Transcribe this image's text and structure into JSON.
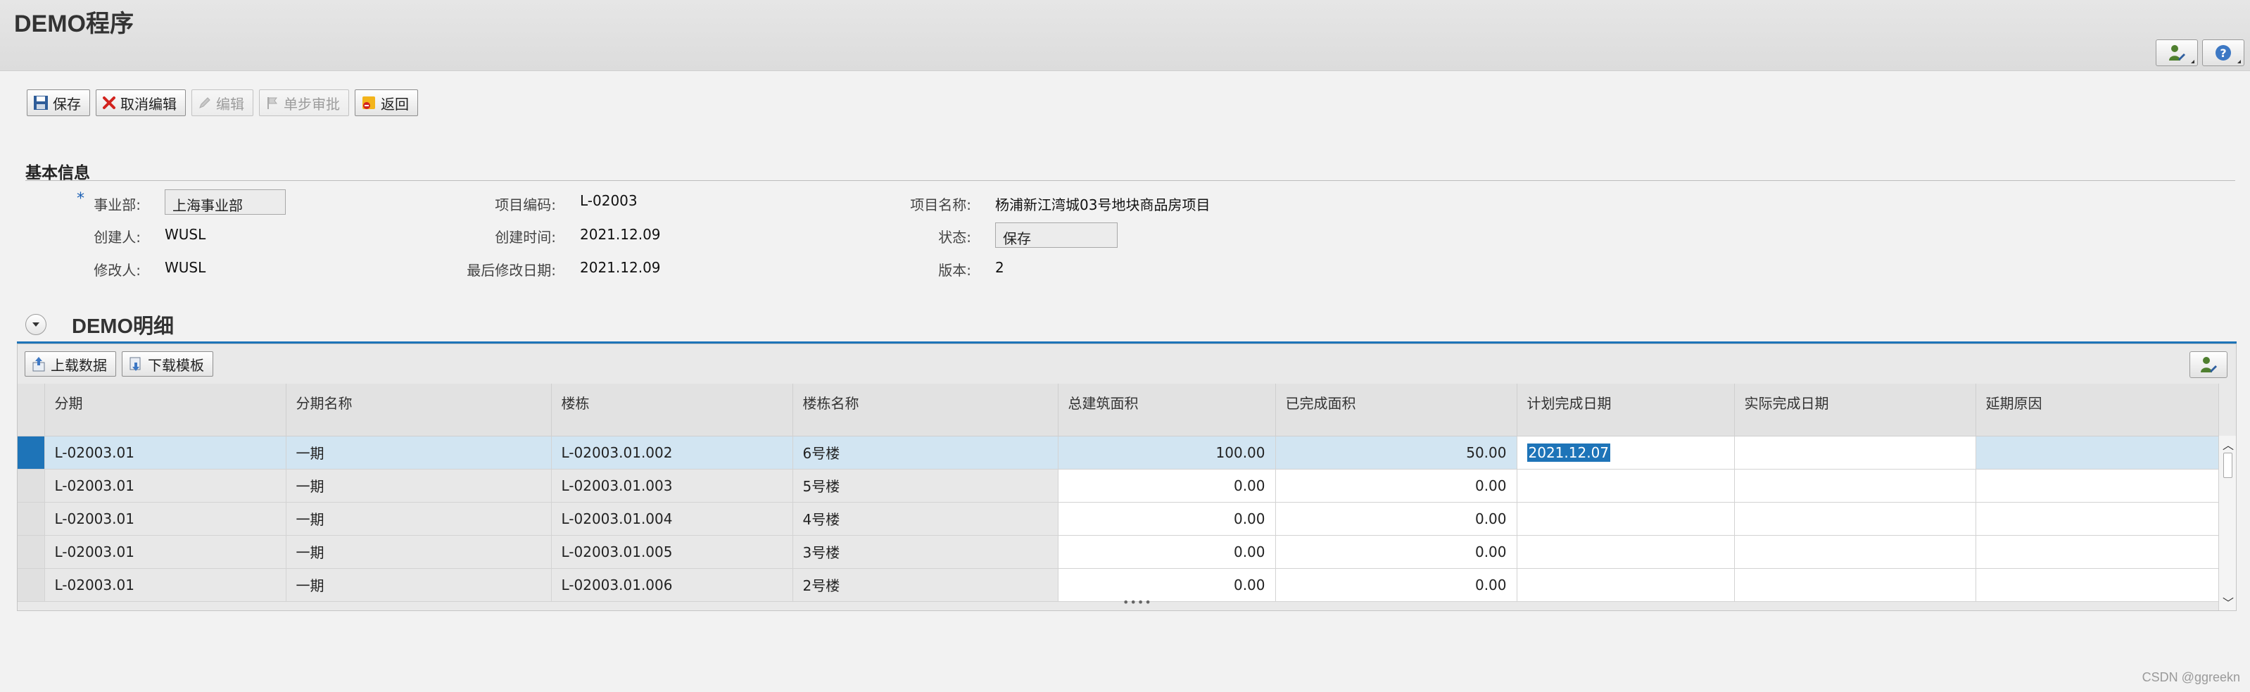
{
  "app": {
    "title": "DEMO程序"
  },
  "toolbar": {
    "buttons": [
      {
        "label": "保存",
        "icon": "save-icon",
        "enabled": true
      },
      {
        "label": "取消编辑",
        "icon": "cancel-icon",
        "enabled": true
      },
      {
        "label": "编辑",
        "icon": "pencil-icon",
        "enabled": false
      },
      {
        "label": "单步审批",
        "icon": "flag-icon",
        "enabled": false
      },
      {
        "label": "返回",
        "icon": "back-icon",
        "enabled": true
      }
    ]
  },
  "basic_info": {
    "section_title": "基本信息",
    "fields": {
      "division_label": "事业部:",
      "division_value": "上海事业部",
      "creator_label": "创建人:",
      "creator_value": "WUSL",
      "modifier_label": "修改人:",
      "modifier_value": "WUSL",
      "project_code_label": "项目编码:",
      "project_code_value": "L-02003",
      "created_time_label": "创建时间:",
      "created_time_value": "2021.12.09",
      "modified_date_label": "最后修改日期:",
      "modified_date_value": "2021.12.09",
      "project_name_label": "项目名称:",
      "project_name_value": "杨浦新江湾城03号地块商品房项目",
      "status_label": "状态:",
      "status_value": "保存",
      "version_label": "版本:",
      "version_value": "2"
    }
  },
  "detail": {
    "title": "DEMO明细",
    "upload_label": "上载数据",
    "download_label": "下载模板",
    "columns": [
      "分期",
      "分期名称",
      "楼栋",
      "楼栋名称",
      "总建筑面积",
      "已完成面积",
      "计划完成日期",
      "实际完成日期",
      "延期原因"
    ],
    "rows": [
      {
        "phase": "L-02003.01",
        "phase_name": "一期",
        "building": "L-02003.01.002",
        "building_name": "6号楼",
        "total_area": "100.00",
        "done_area": "50.00",
        "plan_date": "2021.12.07",
        "actual_date": "",
        "delay_reason": ""
      },
      {
        "phase": "L-02003.01",
        "phase_name": "一期",
        "building": "L-02003.01.003",
        "building_name": "5号楼",
        "total_area": "0.00",
        "done_area": "0.00",
        "plan_date": "",
        "actual_date": "",
        "delay_reason": ""
      },
      {
        "phase": "L-02003.01",
        "phase_name": "一期",
        "building": "L-02003.01.004",
        "building_name": "4号楼",
        "total_area": "0.00",
        "done_area": "0.00",
        "plan_date": "",
        "actual_date": "",
        "delay_reason": ""
      },
      {
        "phase": "L-02003.01",
        "phase_name": "一期",
        "building": "L-02003.01.005",
        "building_name": "3号楼",
        "total_area": "0.00",
        "done_area": "0.00",
        "plan_date": "",
        "actual_date": "",
        "delay_reason": ""
      },
      {
        "phase": "L-02003.01",
        "phase_name": "一期",
        "building": "L-02003.01.006",
        "building_name": "2号楼",
        "total_area": "0.00",
        "done_area": "0.00",
        "plan_date": "",
        "actual_date": "",
        "delay_reason": ""
      }
    ]
  },
  "watermark": "CSDN @ggreekn",
  "colors": {
    "accent": "#1e74b8",
    "selected_row": "#d2e5f2"
  }
}
